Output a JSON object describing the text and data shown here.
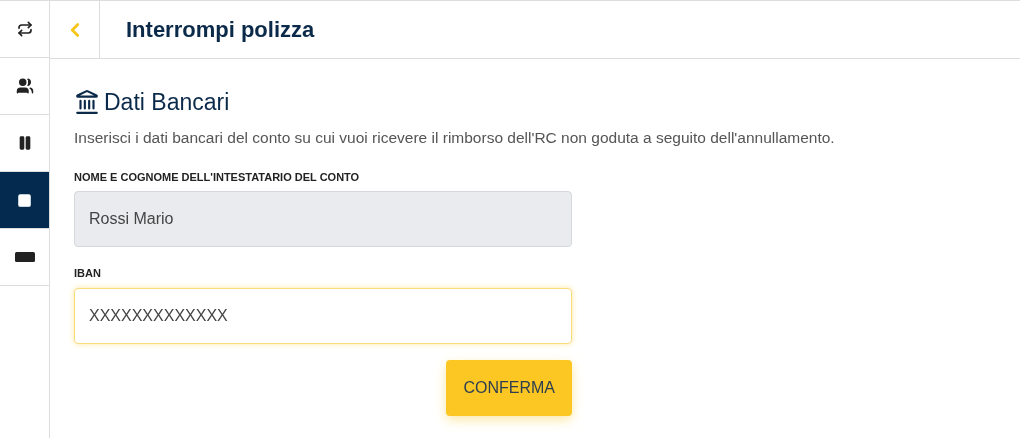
{
  "sidebar": {
    "items": [
      {
        "kind": "repeat",
        "selected": false
      },
      {
        "kind": "users",
        "selected": false
      },
      {
        "kind": "pause",
        "selected": false
      },
      {
        "kind": "stop",
        "selected": true
      },
      {
        "kind": "bar",
        "selected": false
      }
    ]
  },
  "header": {
    "title": "Interrompi polizza"
  },
  "section": {
    "title": "Dati Bancari",
    "description": "Inserisci i dati bancari del conto su cui vuoi ricevere il rimborso dell'RC non goduta a seguito dell'annullamento."
  },
  "fields": [
    {
      "label": "NOME E COGNOME DELL'INTESTATARIO DEL CONTO",
      "value": "Rossi Mario",
      "disabled": true,
      "focused": false
    },
    {
      "label": "IBAN",
      "value": "XXXXXXXXXXXXX",
      "disabled": false,
      "focused": true
    }
  ],
  "button": {
    "label": "CONFERMA"
  }
}
